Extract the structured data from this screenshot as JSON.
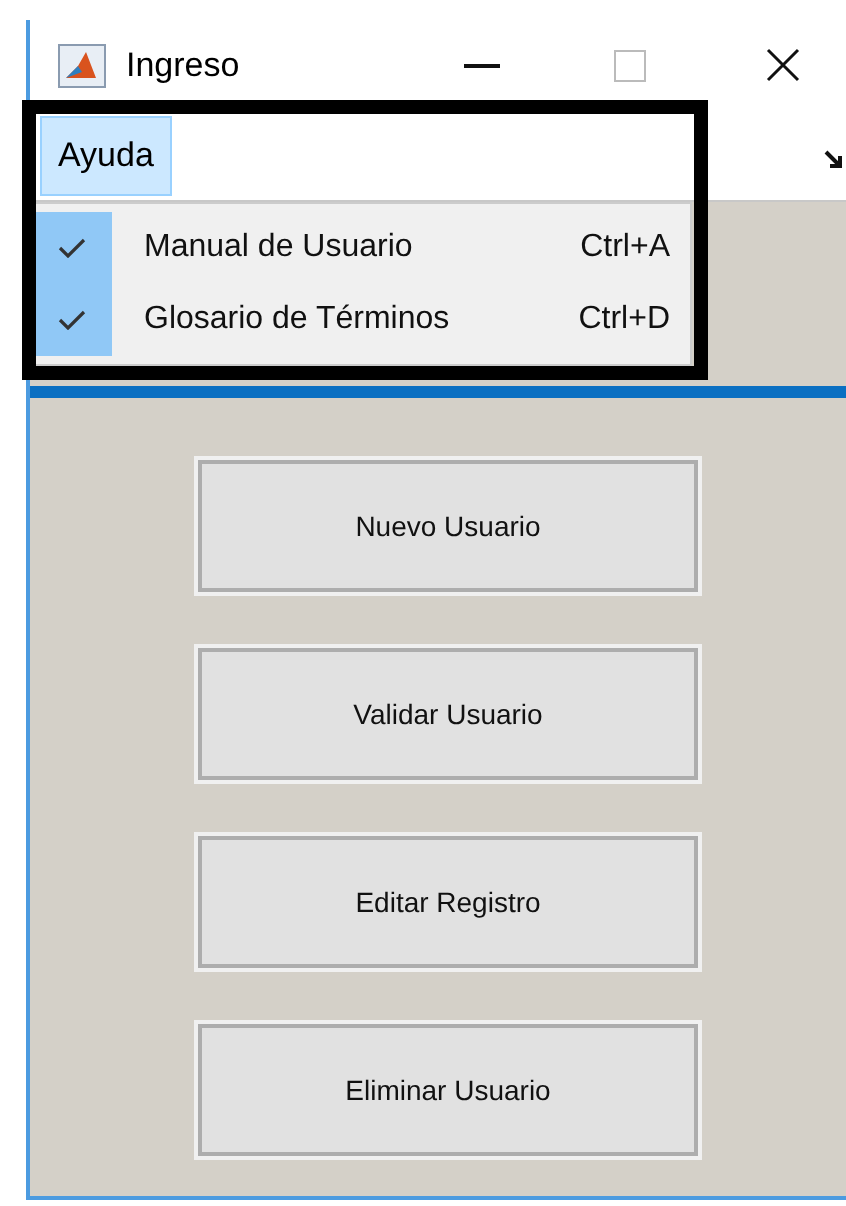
{
  "window": {
    "title": "Ingreso"
  },
  "menu_bar": [
    {
      "label": "Ayuda",
      "selected": true
    }
  ],
  "dropdown": [
    {
      "label": "Manual de Usuario",
      "shortcut": "Ctrl+A",
      "checked": true
    },
    {
      "label": "Glosario de Términos",
      "shortcut": "Ctrl+D",
      "checked": true
    }
  ],
  "buttons": [
    "Nuevo Usuario",
    "Validar Usuario",
    "Editar Registro",
    "Eliminar Usuario"
  ]
}
